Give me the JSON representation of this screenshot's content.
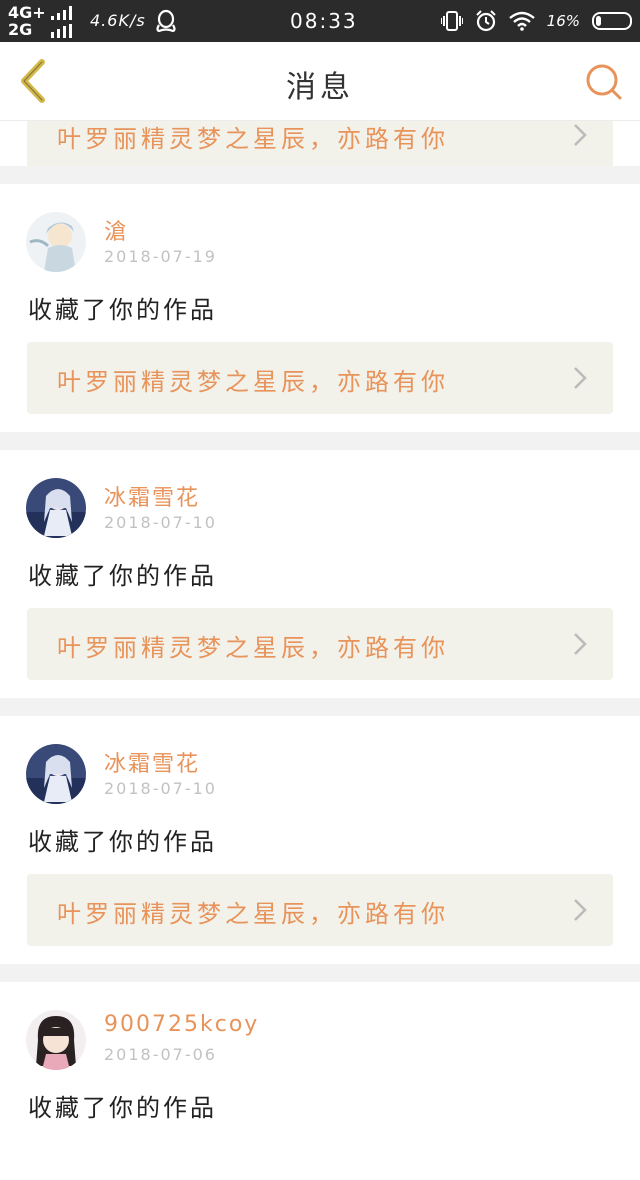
{
  "status_bar": {
    "network_top": "4G+",
    "network_bottom": "2G",
    "speed": "4.6K/s",
    "time": "08:33",
    "battery": "16%",
    "battery_level": 0.16,
    "icons": [
      "signal-bars-icon",
      "qq-icon",
      "vibrate-icon",
      "alarm-icon",
      "wifi-icon",
      "battery-icon"
    ]
  },
  "nav": {
    "title": "消息",
    "back_icon": "chevron-left-icon",
    "search_icon": "search-icon"
  },
  "colors": {
    "accent": "#e8935a",
    "back_icon": "#d4b84a",
    "work_box_bg": "#f2f2ea",
    "page_bg": "#f2f2f2"
  },
  "partial_card": {
    "work_title": "叶罗丽精灵梦之星辰，亦路有你"
  },
  "notifications": [
    {
      "user": "滄",
      "date": "2018-07-19",
      "action": "收藏了你的作品",
      "work_title": "叶罗丽精灵梦之星辰，亦路有你"
    },
    {
      "user": "冰霜雪花",
      "date": "2018-07-10",
      "action": "收藏了你的作品",
      "work_title": "叶罗丽精灵梦之星辰，亦路有你"
    },
    {
      "user": "冰霜雪花",
      "date": "2018-07-10",
      "action": "收藏了你的作品",
      "work_title": "叶罗丽精灵梦之星辰，亦路有你"
    },
    {
      "user": "900725kcoy",
      "date": "2018-07-06",
      "action": "收藏了你的作品"
    }
  ]
}
